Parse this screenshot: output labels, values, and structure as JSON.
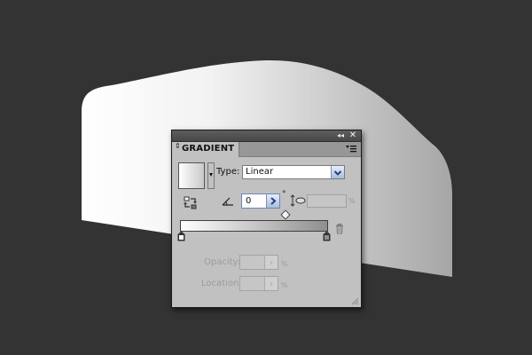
{
  "canvas": {
    "background": "#333333",
    "shape_fill_start": "#ffffff",
    "shape_fill_end": "#a6a6a6"
  },
  "panel": {
    "tab_label": "GRADIENT",
    "tab_icon": "panel-expand-arrows-icon",
    "menu_icon": "panel-menu-icon",
    "topbar_collapse_label": "◂◂",
    "topbar_close_label": "✕",
    "type_label": "Type:",
    "type_value": "Linear",
    "type_dropdown_icon": "chevron-down-icon",
    "reverse_icon": "reverse-gradient-icon",
    "angle_icon": "angle-icon",
    "angle_value": "0",
    "degree_symbol": "°",
    "aspect_icon": "aspect-ratio-icon",
    "aspect_unit": "%",
    "trash_icon": "trash-icon",
    "opacity_label": "Opacity:",
    "opacity_unit": "%",
    "location_label": "Location:",
    "location_unit": "%",
    "gradient_start_color": "#ffffff",
    "gradient_end_color": "#8f8f8f",
    "accent_button_color": "#a9bddc"
  }
}
